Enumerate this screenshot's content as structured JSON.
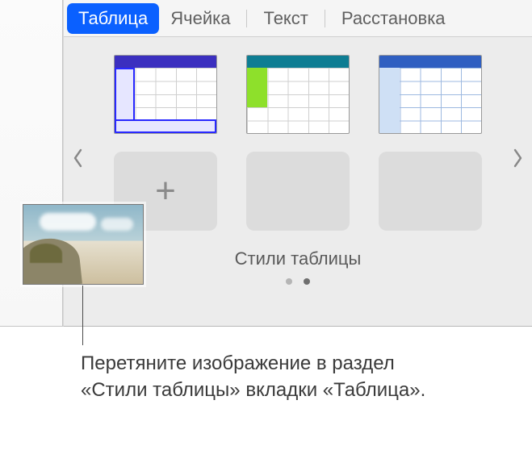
{
  "tabs": {
    "table": "Таблица",
    "cell": "Ячейка",
    "text": "Текст",
    "arrange": "Расстановка"
  },
  "styles": {
    "label": "Стили таблицы"
  },
  "caption": "Перетяните изображение в раздел «Стили таблицы» вкладки «Таблица».",
  "icons": {
    "plus": "+"
  }
}
